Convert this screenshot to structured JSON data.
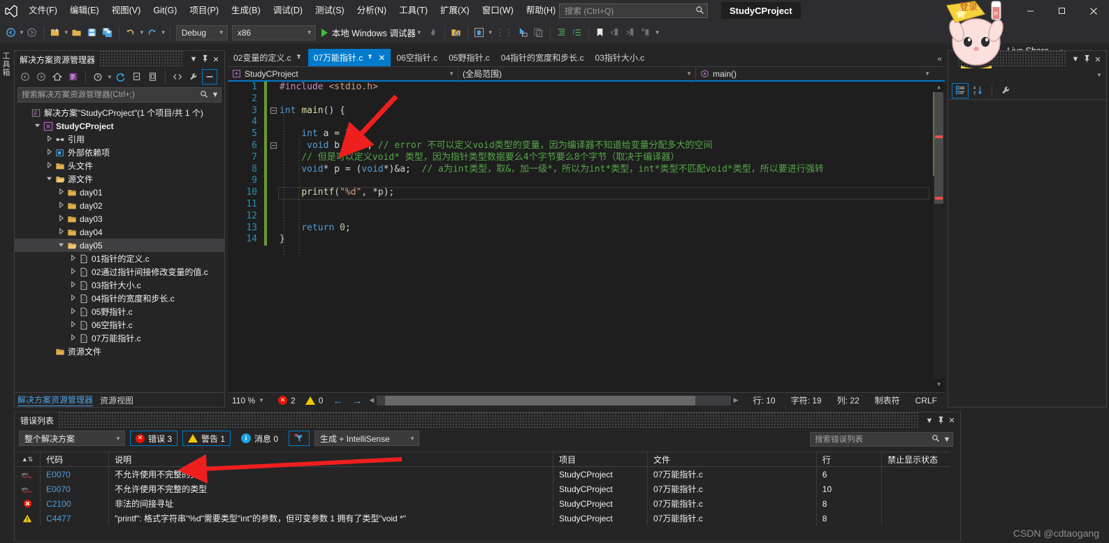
{
  "window": {
    "project_chip": "StudyCProject",
    "minimize": "─",
    "maximize": "❐",
    "close": "✕"
  },
  "menu": {
    "items": [
      {
        "label": "文件(F)",
        "name": "menu-file"
      },
      {
        "label": "编辑(E)",
        "name": "menu-edit"
      },
      {
        "label": "视图(V)",
        "name": "menu-view"
      },
      {
        "label": "Git(G)",
        "name": "menu-git"
      },
      {
        "label": "项目(P)",
        "name": "menu-project"
      },
      {
        "label": "生成(B)",
        "name": "menu-build"
      },
      {
        "label": "调试(D)",
        "name": "menu-debug"
      },
      {
        "label": "测试(S)",
        "name": "menu-test"
      },
      {
        "label": "分析(N)",
        "name": "menu-analyze"
      },
      {
        "label": "工具(T)",
        "name": "menu-tools"
      },
      {
        "label": "扩展(X)",
        "name": "menu-extensions"
      },
      {
        "label": "窗口(W)",
        "name": "menu-window"
      },
      {
        "label": "帮助(H)",
        "name": "menu-help"
      }
    ]
  },
  "search": {
    "placeholder": "搜索 (Ctrl+Q)",
    "value": "",
    "icon": "search-icon"
  },
  "toolbar": {
    "config": "Debug",
    "platform": "x86",
    "run_label": "本地 Windows 调试器",
    "live_share": "Live Share"
  },
  "left_rail": {
    "toolbox": "工具箱"
  },
  "solution_explorer": {
    "title": "解决方案资源管理器",
    "search_placeholder": "搜索解决方案资源管理器(Ctrl+;)",
    "search_value": "",
    "tabs": [
      {
        "label": "解决方案资源管理器",
        "active": true
      },
      {
        "label": "资源视图",
        "active": false
      }
    ],
    "tree": [
      {
        "label": "解决方案\"StudyCProject\"(1 个项目/共 1 个)",
        "indent": 0,
        "twisty": "",
        "icon": "solution-icon",
        "bold": false
      },
      {
        "label": "StudyCProject",
        "indent": 1,
        "twisty": "expanded",
        "icon": "project-icon",
        "bold": true
      },
      {
        "label": "引用",
        "indent": 2,
        "twisty": "collapsed",
        "icon": "references-icon",
        "bold": false
      },
      {
        "label": "外部依赖项",
        "indent": 2,
        "twisty": "collapsed",
        "icon": "ext-dep-icon",
        "bold": false
      },
      {
        "label": "头文件",
        "indent": 2,
        "twisty": "collapsed",
        "icon": "folder-icon",
        "bold": false
      },
      {
        "label": "源文件",
        "indent": 2,
        "twisty": "expanded",
        "icon": "folder-open-icon",
        "bold": false
      },
      {
        "label": "day01",
        "indent": 3,
        "twisty": "collapsed",
        "icon": "folder-icon",
        "bold": false
      },
      {
        "label": "day02",
        "indent": 3,
        "twisty": "collapsed",
        "icon": "folder-icon",
        "bold": false
      },
      {
        "label": "day03",
        "indent": 3,
        "twisty": "collapsed",
        "icon": "folder-icon",
        "bold": false
      },
      {
        "label": "day04",
        "indent": 3,
        "twisty": "collapsed",
        "icon": "folder-icon",
        "bold": false
      },
      {
        "label": "day05",
        "indent": 3,
        "twisty": "expanded",
        "icon": "folder-open-icon",
        "bold": false,
        "selected": true
      },
      {
        "label": "01指针的定义.c",
        "indent": 4,
        "twisty": "collapsed",
        "icon": "c-file-icon",
        "bold": false
      },
      {
        "label": "02通过指针间接修改变量的值.c",
        "indent": 4,
        "twisty": "collapsed",
        "icon": "c-file-icon",
        "bold": false
      },
      {
        "label": "03指针大小.c",
        "indent": 4,
        "twisty": "collapsed",
        "icon": "c-file-icon",
        "bold": false
      },
      {
        "label": "04指针的宽度和步长.c",
        "indent": 4,
        "twisty": "collapsed",
        "icon": "c-file-icon",
        "bold": false
      },
      {
        "label": "05野指针.c",
        "indent": 4,
        "twisty": "collapsed",
        "icon": "c-file-icon",
        "bold": false
      },
      {
        "label": "06空指针.c",
        "indent": 4,
        "twisty": "collapsed",
        "icon": "c-file-icon",
        "bold": false
      },
      {
        "label": "07万能指针.c",
        "indent": 4,
        "twisty": "collapsed",
        "icon": "c-file-icon",
        "bold": false
      },
      {
        "label": "资源文件",
        "indent": 2,
        "twisty": "",
        "icon": "folder-icon",
        "bold": false
      }
    ]
  },
  "editor": {
    "tabs": [
      {
        "label": "02变量的定义.c",
        "active": false,
        "pinned": true
      },
      {
        "label": "07万能指针.c",
        "active": true,
        "pinned": true,
        "closable": true
      },
      {
        "label": "06空指针.c",
        "active": false
      },
      {
        "label": "05野指针.c",
        "active": false
      },
      {
        "label": "04指针的宽度和步长.c",
        "active": false
      },
      {
        "label": "03指针大小.c",
        "active": false
      }
    ],
    "overflow_glyph": "«",
    "navbar": {
      "project": "StudyCProject",
      "scope": "(全局范围)",
      "member": "main()"
    },
    "lines": [
      {
        "n": 1,
        "fold": "",
        "html": "#include &lt;stdio.h&gt;",
        "changed": true
      },
      {
        "n": 2,
        "fold": "",
        "html": "",
        "changed": true
      },
      {
        "n": 3,
        "fold": "minus",
        "html": "int main() {",
        "changed": true
      },
      {
        "n": 4,
        "fold": "",
        "html": "",
        "changed": true
      },
      {
        "n": 5,
        "fold": "",
        "html": "    int a = 10;",
        "changed": true
      },
      {
        "n": 6,
        "fold": "minus",
        "html": "     void b = 20; // error 不可以定义void类型的变量，因为编译器不知道给变量分配多大的空间",
        "changed": true
      },
      {
        "n": 7,
        "fold": "",
        "html": "    // 但是可以定义void* 类型，因为指针类型数据要么4个字节要么8个字节（取决于编译器）",
        "changed": true
      },
      {
        "n": 8,
        "fold": "",
        "html": "    void* p = (void*)&a;  // a为int类型，取&，加一级*，所以为int*类型，int*类型不匹配void*类型，所以要进行强转",
        "changed": true
      },
      {
        "n": 9,
        "fold": "",
        "html": "",
        "changed": true
      },
      {
        "n": 10,
        "fold": "",
        "html": "    printf(\"%d\", *p);",
        "changed": true,
        "current": true
      },
      {
        "n": 11,
        "fold": "",
        "html": "",
        "changed": true
      },
      {
        "n": 12,
        "fold": "",
        "html": "",
        "changed": true
      },
      {
        "n": 13,
        "fold": "",
        "html": "    return 0;",
        "changed": true
      },
      {
        "n": 14,
        "fold": "",
        "html": "}",
        "changed": true
      }
    ],
    "status": {
      "zoom": "110 %",
      "error_count": "2",
      "warning_count": "0",
      "line_label": "行: 10",
      "char_label": "字符: 19",
      "col_label": "列: 22",
      "tab_label": "制表符",
      "eol_label": "CRLF"
    }
  },
  "properties": {
    "title": "",
    "toolbar_icons": [
      "categorized-icon",
      "alphabetical-icon",
      "properties-wrench-icon"
    ]
  },
  "error_list": {
    "title": "错误列表",
    "scope_filter": "整个解决方案",
    "build_filter": "生成 + IntelliSense",
    "chips": [
      {
        "label": "错误 3",
        "kind": "error",
        "active": true
      },
      {
        "label": "警告 1",
        "kind": "warning",
        "active": true
      },
      {
        "label": "消息 0",
        "kind": "message",
        "active": false
      }
    ],
    "clear_filter_icon": "clear-filter-icon",
    "search_placeholder": "搜索错误列表",
    "search_value": "",
    "columns": [
      "",
      "代码",
      "说明",
      "项目",
      "文件",
      "行",
      "禁止显示状态"
    ],
    "rows": [
      {
        "severity": "intellisense",
        "code": "E0070",
        "desc": "不允许使用不完整的类型",
        "project": "StudyCProject",
        "file": "07万能指针.c",
        "line": "6",
        "suppress": ""
      },
      {
        "severity": "intellisense",
        "code": "E0070",
        "desc": "不允许使用不完整的类型",
        "project": "StudyCProject",
        "file": "07万能指针.c",
        "line": "10",
        "suppress": ""
      },
      {
        "severity": "error",
        "code": "C2100",
        "desc": "非法的间接寻址",
        "project": "StudyCProject",
        "file": "07万能指针.c",
        "line": "8",
        "suppress": ""
      },
      {
        "severity": "warning",
        "code": "C4477",
        "desc": "\"printf\": 格式字符串\"%d\"需要类型\"int\"的参数，但可变参数 1 拥有了类型\"void *\"",
        "project": "StudyCProject",
        "file": "07万能指针.c",
        "line": "8",
        "suppress": ""
      }
    ]
  },
  "watermark": "CSDN @cdtaogang",
  "colors": {
    "accent": "#007acc",
    "error": "#e51400",
    "warning": "#f0c808",
    "comment": "#57a64a",
    "keyword": "#569cd6",
    "link": "#4ea0e0"
  }
}
